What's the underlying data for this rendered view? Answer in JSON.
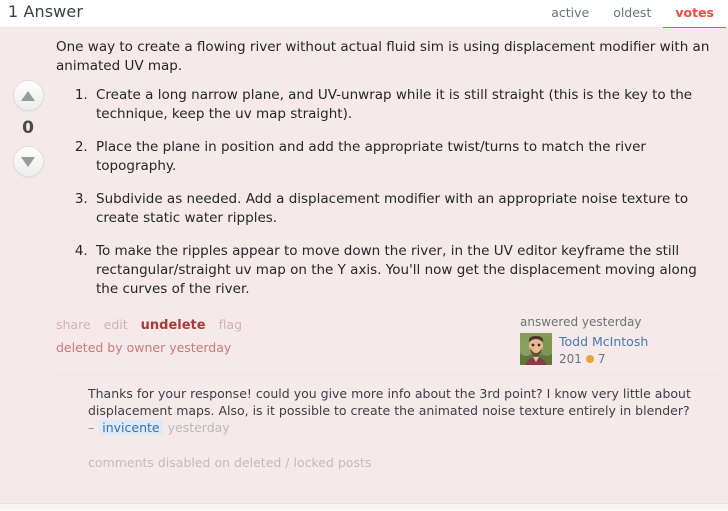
{
  "header": {
    "answers_count_label": "1 Answer",
    "tabs": [
      {
        "label": "active",
        "active": false
      },
      {
        "label": "oldest",
        "active": false
      },
      {
        "label": "votes",
        "active": true
      }
    ],
    "active_tab_color": "#f4483c"
  },
  "post": {
    "vote": {
      "score": "0",
      "upvote_title": "upvote",
      "downvote_title": "downvote"
    },
    "body": {
      "intro": "One way to create a flowing river without actual fluid sim is using displacement modifier with an animated UV map.",
      "steps": [
        "Create a long narrow plane, and UV-unwrap while it is still straight (this is the key to the technique, keep the uv map straight).",
        "Place the plane in position and add the appropriate twist/turns to match the river topography.",
        "Subdivide as needed. Add a displacement modifier with an appropriate noise texture to create static water ripples.",
        "To make the ripples appear to move down the river, in the UV editor keyframe the still rectangular/straight uv map on the Y axis. You'll now get the displacement moving along the curves of the river."
      ]
    },
    "actions": [
      {
        "label": "share",
        "strong": false
      },
      {
        "label": "edit",
        "strong": false
      },
      {
        "label": "undelete",
        "strong": true
      },
      {
        "label": "flag",
        "strong": false
      }
    ],
    "deleted_note": "deleted by owner yesterday",
    "user": {
      "answered_label": "answered yesterday",
      "name": "Todd McIntosh",
      "reputation": "201",
      "badge_count": "7",
      "badge_color": "#e8a33d",
      "avatar_alt": "avatar"
    }
  },
  "comments": [
    {
      "text": "Thanks for your response! could you give more info about the 3rd point? I know very little about displacement maps. Also, is it possible to create the animated noise texture entirely in blender?",
      "dash": "–",
      "author": "invicente",
      "date": "yesterday"
    }
  ],
  "comments_disabled_label": "comments disabled on deleted / locked posts"
}
